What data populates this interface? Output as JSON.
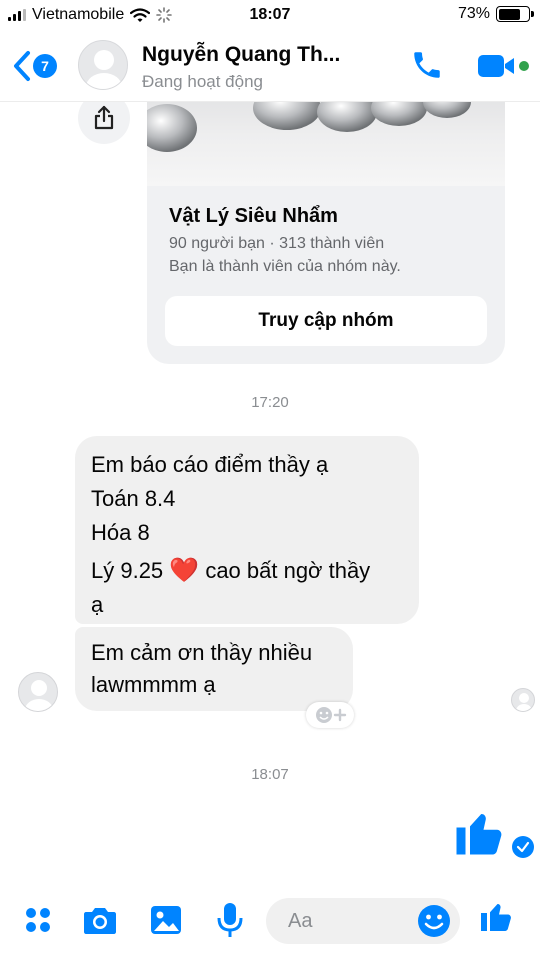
{
  "status_bar": {
    "carrier": "Vietnamobile",
    "time": "18:07",
    "battery": "73%",
    "battery_level": 0.73,
    "signal_bars_active": 3,
    "signal_bars_total": 4
  },
  "header": {
    "back_badge": "7",
    "contact_name": "Nguyễn Quang Th...",
    "contact_status": "Đang hoạt động"
  },
  "group_card": {
    "title": "Vật Lý Siêu Nhẩm",
    "meta": "90 người bạn · 313 thành viên",
    "membership": "Bạn là thành viên của nhóm này.",
    "button": "Truy cập nhóm"
  },
  "timestamps": [
    "17:20",
    "18:07"
  ],
  "messages": [
    {
      "lines": [
        "Em báo cáo điểm thầy ạ",
        "Toán 8.4",
        "Hóa 8",
        "Lý 9.25",
        "cao bất ngờ thầy",
        "ạ"
      ],
      "emoji": "❤️"
    },
    {
      "lines": [
        "Em cảm ơn thầy nhiều",
        "lawmmmm ạ"
      ]
    }
  ],
  "composer": {
    "placeholder": "Aa"
  },
  "colors": {
    "accent": "#0084ff",
    "bubble": "#f0f0f0",
    "online": "#31a24c",
    "heart": "#e8162e"
  },
  "icons": [
    "signal-icon",
    "wifi-icon",
    "loading-icon",
    "battery-icon",
    "back-chevron-icon",
    "phone-icon",
    "video-icon",
    "share-icon",
    "add-reaction-icon",
    "like-icon",
    "sent-check-icon",
    "menu-dots-icon",
    "camera-icon",
    "image-icon",
    "microphone-icon",
    "emoji-icon"
  ]
}
